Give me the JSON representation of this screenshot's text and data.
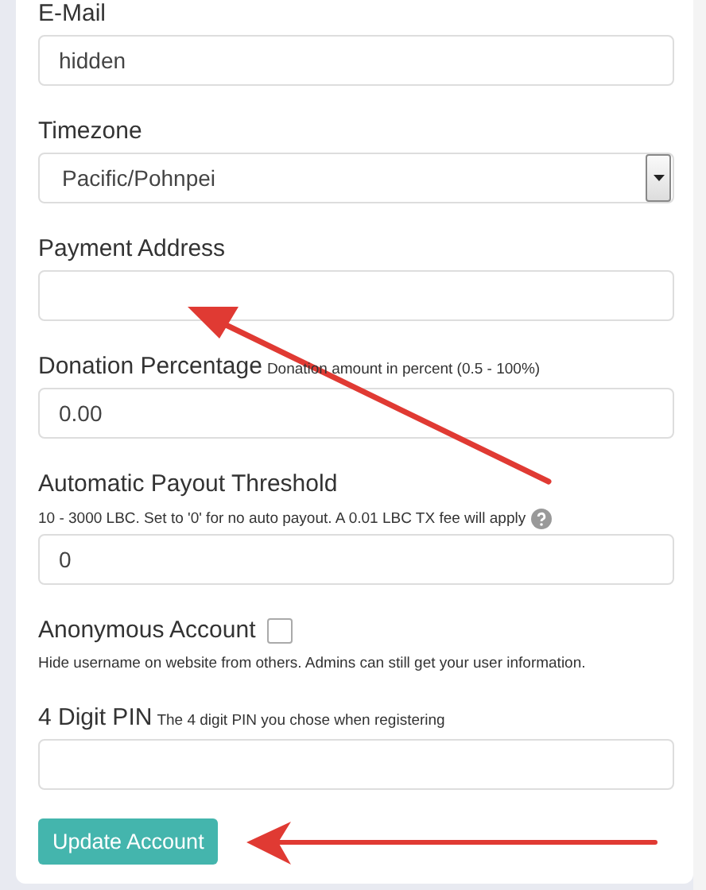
{
  "fields": [
    {
      "kind": "text",
      "label": "E-Mail",
      "value": "hidden"
    },
    {
      "kind": "select",
      "label": "Timezone",
      "value": "Pacific/Pohnpei"
    },
    {
      "kind": "text",
      "label": "Payment Address"
    },
    {
      "kind": "text",
      "label": "Donation Percentage",
      "hint_inline": "Donation amount in percent (0.5 - 100%)",
      "value": "0.00"
    },
    {
      "kind": "text",
      "label": "Automatic Payout Threshold",
      "hint": "10 - 3000 LBC. Set to '0' for no auto payout. A 0.01 LBC TX fee will apply",
      "help_icon": true,
      "value": "0"
    },
    {
      "kind": "checkbox",
      "label": "Anonymous Account",
      "checked": false,
      "hint": "Hide username on website from others. Admins can still get your user information."
    },
    {
      "kind": "text",
      "label": "4 Digit PIN",
      "hint_inline": "The 4 digit PIN you chose when registering"
    }
  ],
  "button": "Update Account"
}
